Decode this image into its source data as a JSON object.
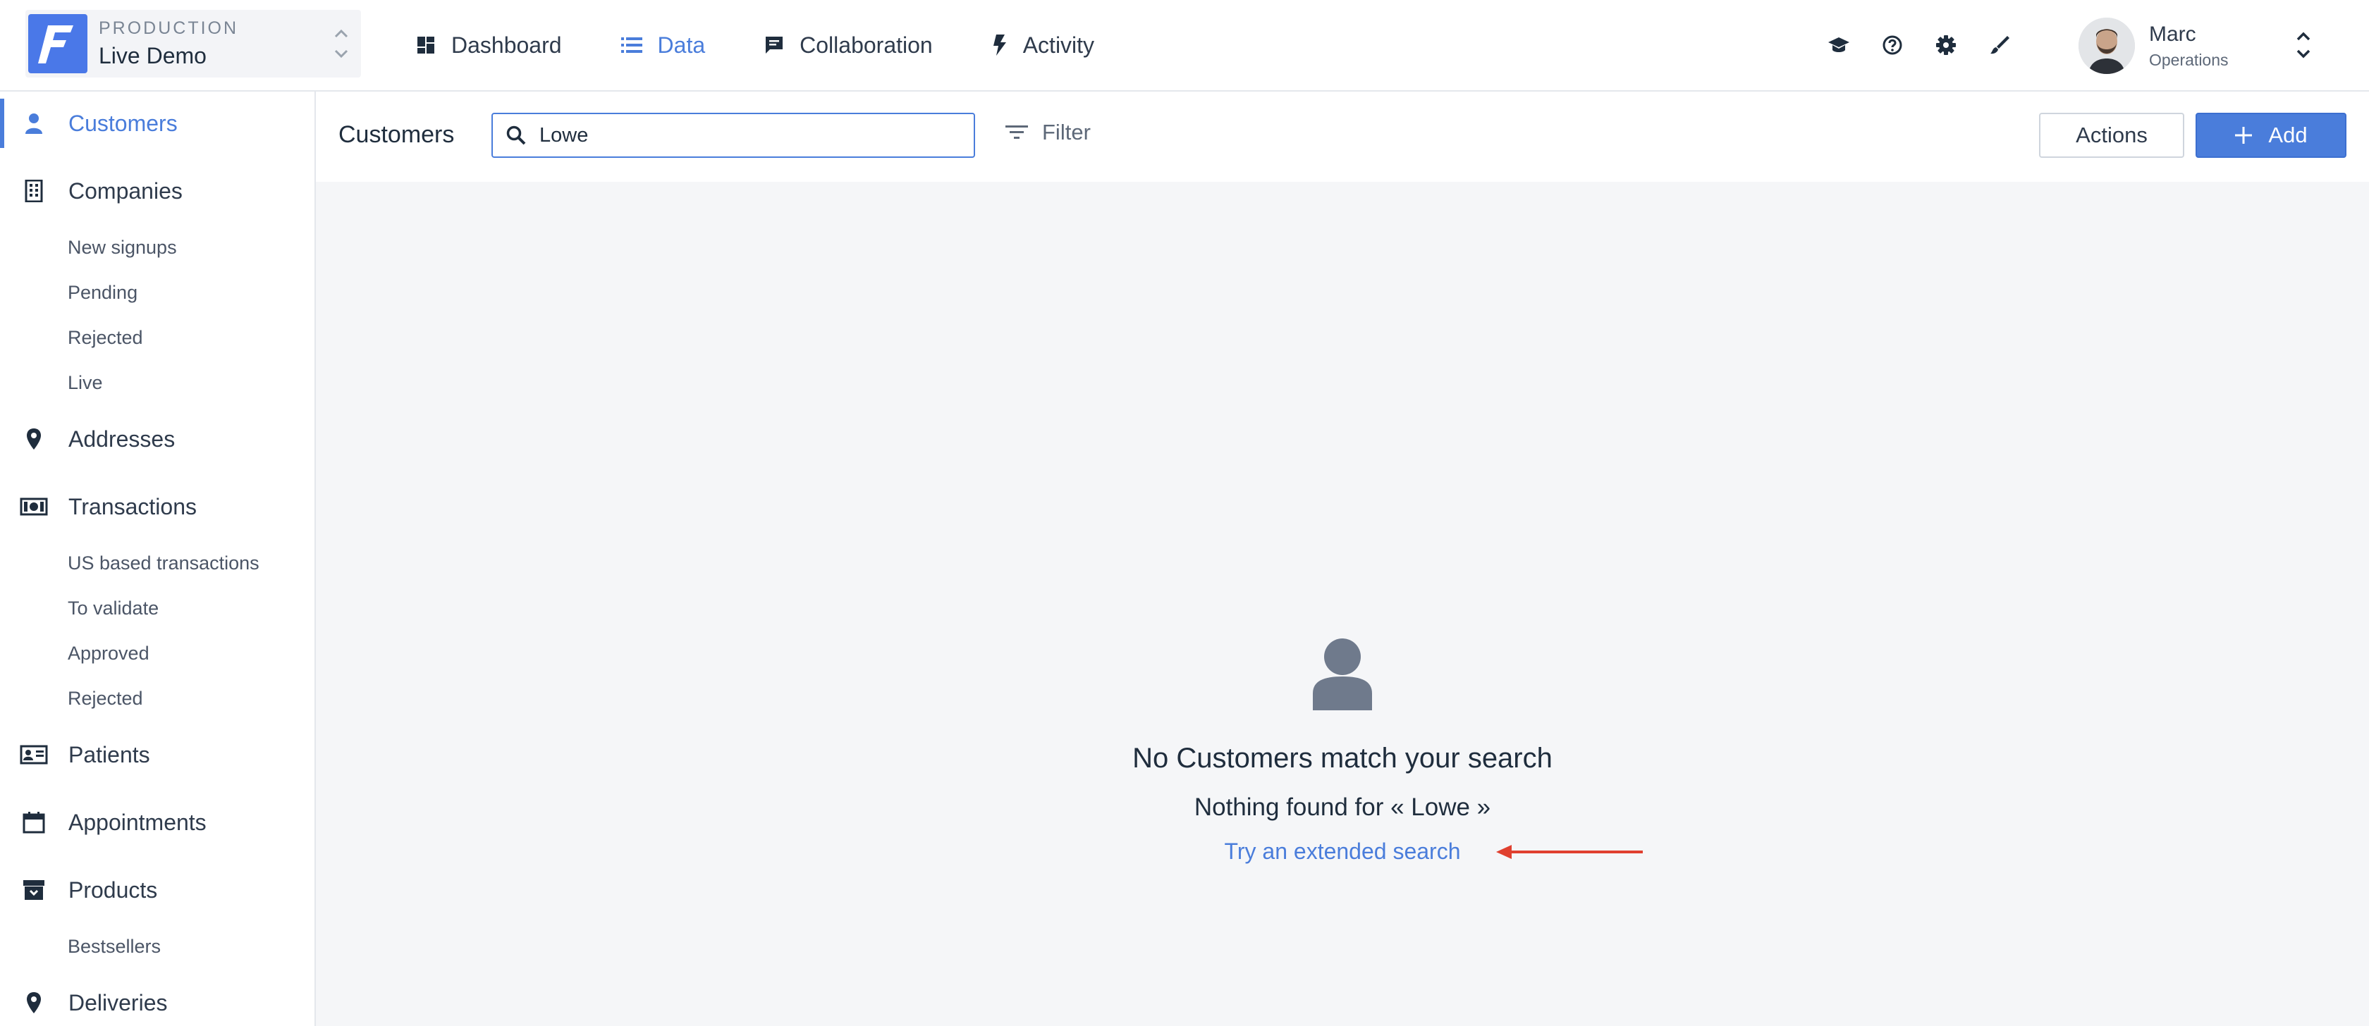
{
  "project": {
    "environment": "PRODUCTION",
    "name": "Live Demo",
    "logo_letter": "F"
  },
  "topnav": [
    {
      "label": "Dashboard",
      "icon": "dashboard-icon",
      "active": false
    },
    {
      "label": "Data",
      "icon": "list-icon",
      "active": true
    },
    {
      "label": "Collaboration",
      "icon": "chat-icon",
      "active": false
    },
    {
      "label": "Activity",
      "icon": "bolt-icon",
      "active": false
    }
  ],
  "top_icons": [
    "graduation-cap-icon",
    "help-icon",
    "gear-icon",
    "brush-icon"
  ],
  "user": {
    "name": "Marc",
    "role": "Operations"
  },
  "sidebar": {
    "items": [
      {
        "label": "Customers",
        "icon": "person-icon",
        "active": true
      },
      {
        "label": "Companies",
        "icon": "building-icon"
      },
      {
        "label": "Addresses",
        "icon": "pin-icon"
      },
      {
        "label": "Transactions",
        "icon": "banknote-icon"
      },
      {
        "label": "Patients",
        "icon": "id-card-icon"
      },
      {
        "label": "Appointments",
        "icon": "calendar-icon"
      },
      {
        "label": "Products",
        "icon": "archive-icon"
      },
      {
        "label": "Deliveries",
        "icon": "pin-icon"
      }
    ],
    "companies_segments": [
      "New signups",
      "Pending",
      "Rejected",
      "Live"
    ],
    "transactions_segments": [
      "US based transactions",
      "To validate",
      "Approved",
      "Rejected"
    ],
    "products_segments": [
      "Bestsellers"
    ]
  },
  "toolbar": {
    "title": "Customers",
    "search_value": "Lowe",
    "filter_label": "Filter",
    "actions_label": "Actions",
    "add_label": "Add"
  },
  "empty_state": {
    "title": "No Customers match your search",
    "subtitle": "Nothing found for « Lowe »",
    "link": "Try an extended search"
  },
  "colors": {
    "accent": "#4a7ddb",
    "annotation_arrow": "#e0402f"
  }
}
